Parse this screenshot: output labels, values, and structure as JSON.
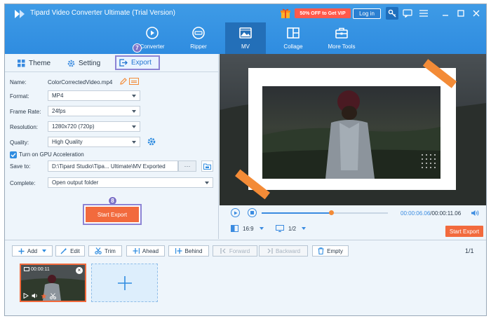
{
  "window": {
    "title": "Tipard Video Converter Ultimate (Trial Version)",
    "promo": "50% OFF to Get VIP",
    "login_label": "Log in"
  },
  "nav_tabs": [
    {
      "label": "Converter",
      "icon": "refresh-film-icon"
    },
    {
      "label": "Ripper",
      "icon": "disc-icon"
    },
    {
      "label": "MV",
      "icon": "image-icon",
      "active": true
    },
    {
      "label": "Collage",
      "icon": "collage-grid-icon"
    },
    {
      "label": "More Tools",
      "icon": "toolbox-icon"
    }
  ],
  "subtabs": {
    "theme": "Theme",
    "setting": "Setting",
    "export": "Export"
  },
  "steps": {
    "export_step": "7",
    "start_step": "8"
  },
  "export_form": {
    "name_label": "Name:",
    "name_value": "ColorCorrectedVideo.mp4",
    "format_label": "Format:",
    "format_value": "MP4",
    "frame_rate_label": "Frame Rate:",
    "frame_rate_value": "24fps",
    "resolution_label": "Resolution:",
    "resolution_value": "1280x720 (720p)",
    "quality_label": "Quality:",
    "quality_value": "High Quality",
    "gpu_label": "Turn on GPU Acceleration",
    "gpu_checked": true,
    "save_to_label": "Save to:",
    "save_to_value": "D:\\Tipard Studio\\Tipa... Ultimate\\MV Exported",
    "dots_label": "···",
    "complete_label": "Complete:",
    "complete_value": "Open output folder",
    "start_export_label": "Start Export"
  },
  "player": {
    "current_time": "00:00:06.06",
    "total_time": "00:00:11.06",
    "progress": 0.55,
    "aspect_ratio": "16:9",
    "page_ratio": "1/2",
    "start_export_label": "Start Export"
  },
  "timeline_toolbar": {
    "add": "Add",
    "edit": "Edit",
    "trim": "Trim",
    "ahead": "Ahead",
    "behind": "Behind",
    "forward": "Forward",
    "backward": "Backward",
    "empty": "Empty",
    "page_count": "1/1"
  },
  "clips": [
    {
      "duration": "00:00:11"
    }
  ],
  "colors": {
    "brand_blue": "#2f8ce0",
    "accent_orange": "#f26a3d",
    "highlight_purple": "#8d84d4"
  }
}
